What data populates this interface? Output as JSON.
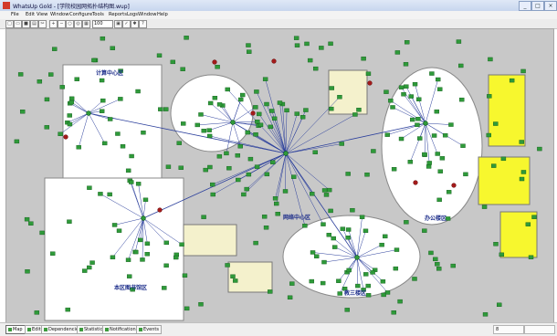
{
  "window": {
    "title": "WhatsUp Gold - [学院校园网拓扑结构图.wup]",
    "controls": [
      "_",
      "□",
      "×"
    ]
  },
  "menu": [
    "File",
    "Edit",
    "View",
    "Window",
    "Configure",
    "Tools",
    "Reports",
    "Logs",
    "Window",
    "Help"
  ],
  "toolbar": {
    "zoom": "100"
  },
  "map": {
    "areas": [
      "计算中心区",
      "本区图书馆区",
      "网络中心区",
      "教三楼区",
      "办公楼区"
    ],
    "colors": {
      "canvas": "#c8c8c8",
      "zone": "#ffffff",
      "node": "#2f9a3a",
      "node_border": "#0d5a16",
      "link": "#2b3f9c",
      "note": "#f7f72e",
      "panel": "#f4f1cc",
      "alert": "#a31a1a"
    }
  },
  "statusbar": {
    "tabs": [
      "Map",
      "Edit",
      "Dependencies",
      "Statistics",
      "Notifications",
      "Events"
    ],
    "zoom_value": "8"
  }
}
